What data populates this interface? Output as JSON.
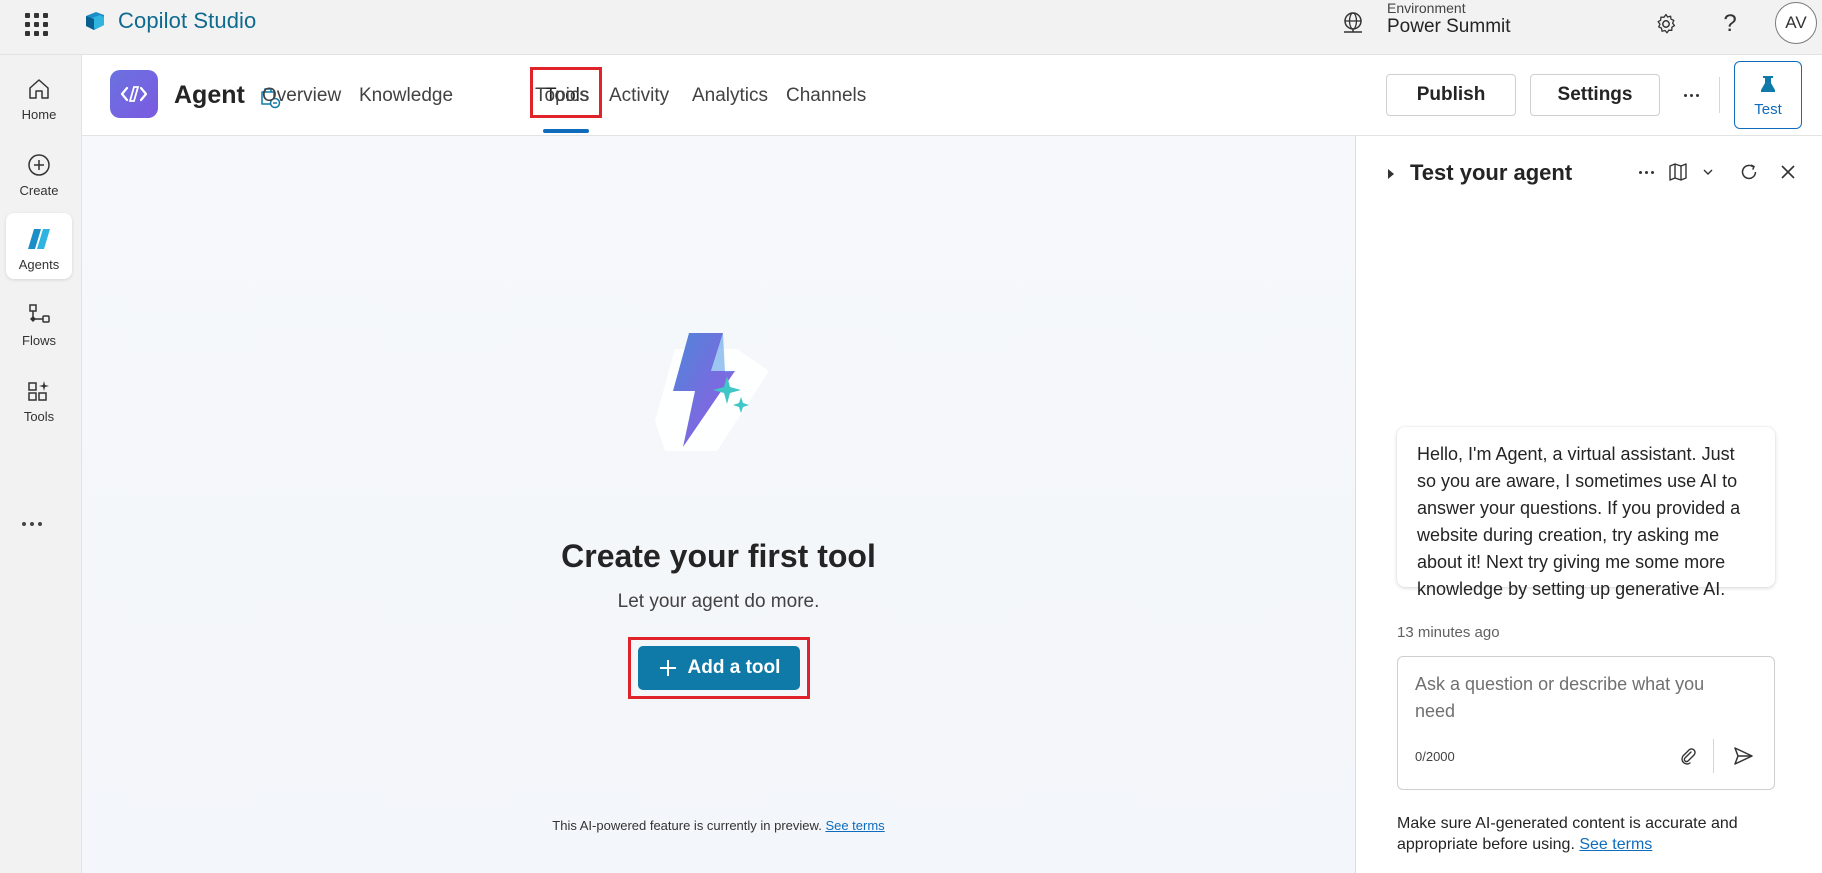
{
  "topbar": {
    "app_name": "Copilot Studio",
    "environment_label": "Environment",
    "environment_name": "Power Summit",
    "avatar_initials": "AV",
    "icons": [
      "waffle-icon",
      "copilot-studio-logo",
      "environment-icon",
      "settings-gear-icon",
      "help-icon"
    ]
  },
  "rail": {
    "items": [
      {
        "label": "Home",
        "icon": "home-icon"
      },
      {
        "label": "Create",
        "icon": "plus-circle-icon"
      },
      {
        "label": "Agents",
        "icon": "agents-icon",
        "active": true
      },
      {
        "label": "Flows",
        "icon": "flows-icon"
      },
      {
        "label": "Tools",
        "icon": "tools-icon"
      }
    ]
  },
  "header": {
    "agent_name": "Agent",
    "tabs": [
      {
        "label": "Overview"
      },
      {
        "label": "Knowledge"
      },
      {
        "label": "Tools",
        "active": true
      },
      {
        "label": "Topics"
      },
      {
        "label": "Activity"
      },
      {
        "label": "Analytics"
      },
      {
        "label": "Channels"
      }
    ],
    "publish_label": "Publish",
    "settings_label": "Settings",
    "test_label": "Test"
  },
  "main": {
    "title": "Create your first tool",
    "subtitle": "Let your agent do more.",
    "add_button_label": "Add a tool",
    "footer_text": "This AI-powered feature is currently in preview.",
    "footer_link": "See terms"
  },
  "test_panel": {
    "title": "Test your agent",
    "message": "Hello, I'm Agent, a virtual assistant. Just so you are aware, I sometimes use AI to answer your questions. If you provided a website during creation, try asking me about it! Next try giving me some more knowledge by setting up generative AI.",
    "timestamp": "13 minutes ago",
    "input_placeholder": "Ask a question or describe what you need",
    "input_value": "",
    "char_count": "0/2000",
    "disclaimer_text": "Make sure AI-generated content is accurate and appropriate before using.",
    "disclaimer_link": "See terms"
  },
  "colors": {
    "accent": "#0f6cbd",
    "primary_button": "#0f7aa8",
    "highlight_box": "#e0232b",
    "brand_text": "#0e6a8f"
  }
}
